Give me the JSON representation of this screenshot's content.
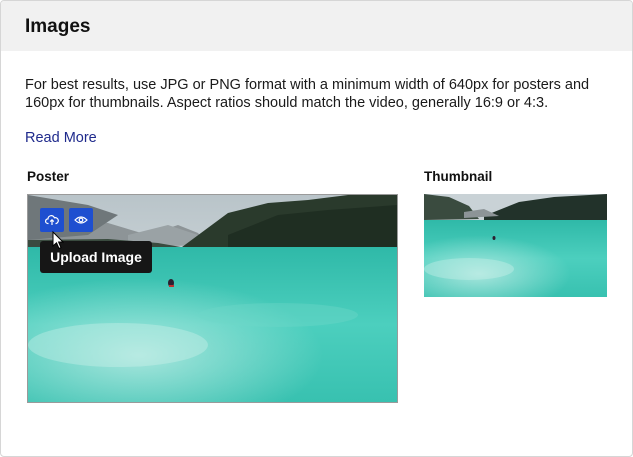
{
  "section": {
    "title": "Images"
  },
  "description": "For best results, use JPG or PNG format with a minimum width of 640px for posters and 160px for thumbnails. Aspect ratios should match the video, generally 16:9 or 4:3.",
  "read_more_label": "Read More",
  "poster": {
    "label": "Poster",
    "tooltip": "Upload Image",
    "upload_icon": "cloud-upload-icon",
    "preview_icon": "eye-icon"
  },
  "thumbnail": {
    "label": "Thumbnail"
  },
  "colors": {
    "header_bg": "#f1f1f1",
    "link": "#1f2a8c",
    "icon_button": "#1e4fd0",
    "tooltip_bg": "#161616",
    "water": "#3fc6b4"
  }
}
